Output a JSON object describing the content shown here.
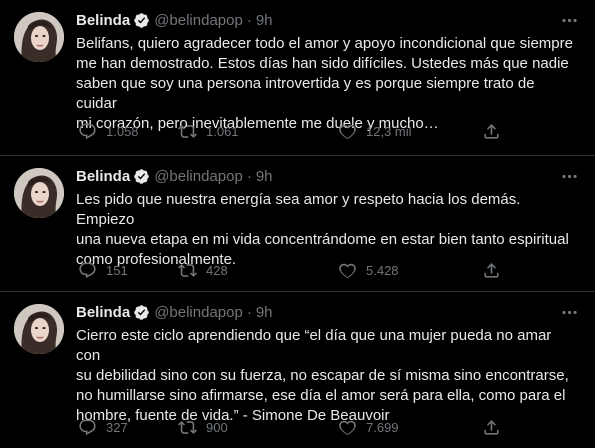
{
  "tweets": [
    {
      "name": "Belinda",
      "handle": "@belindapop",
      "dot": "·",
      "time": "9h",
      "text": "Belifans, quiero agradecer todo el amor y apoyo incondicional que siempre\nme han demostrado. Estos días han sido difíciles. Ustedes más que nadie\nsaben que soy una persona introvertida y es porque siempre trato de cuidar\nmi corazón, pero inevitablemente me duele y mucho…",
      "replies": "1.058",
      "retweets": "1.061",
      "likes": "12,3 mil"
    },
    {
      "name": "Belinda",
      "handle": "@belindapop",
      "dot": "·",
      "time": "9h",
      "text": "Les pido que nuestra energía sea amor y respeto hacia los demás. Empiezo\nuna nueva etapa en mi vida concentrándome en estar bien tanto espiritual\ncomo profesionalmente.",
      "replies": "151",
      "retweets": "428",
      "likes": "5.428"
    },
    {
      "name": "Belinda",
      "handle": "@belindapop",
      "dot": "·",
      "time": "9h",
      "text": "Cierro este ciclo aprendiendo que “el día que una mujer pueda no amar con\nsu debilidad sino con su fuerza, no escapar de sí misma sino encontrarse,\nno humillarse sino afirmarse, ese día el amor será para ella, como para el\nhombre, fuente de vida.” - Simone De Beauvoir",
      "replies": "327",
      "retweets": "900",
      "likes": "7.699"
    }
  ],
  "icons": {
    "verified": "verified-badge-icon",
    "more": "more-options-icon",
    "reply": "reply-icon",
    "retweet": "retweet-icon",
    "like": "heart-icon",
    "share": "share-icon"
  },
  "colors": {
    "background": "#000000",
    "text": "#e7e9ea",
    "muted": "#71767b",
    "verified": "#1d9bf0",
    "divider": "#2f3336"
  }
}
